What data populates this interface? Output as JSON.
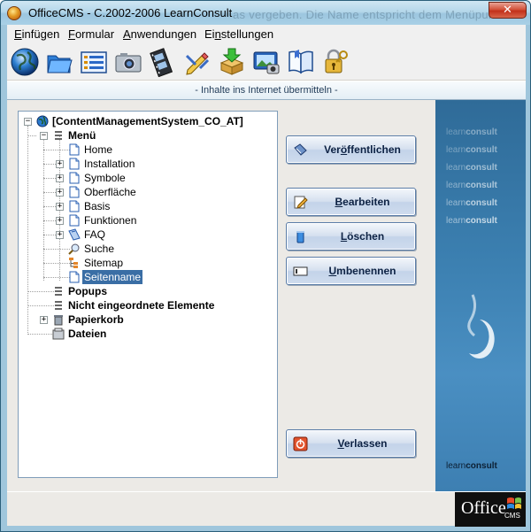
{
  "window": {
    "title": "OfficeCMS - C.2002-2006 LearnConsult",
    "ghost_title": "as vergeben. Die Name entspricht dem Menüpunkt",
    "close_symbol": "✕"
  },
  "menubar": {
    "items": [
      {
        "accel": "E",
        "rest": "infügen"
      },
      {
        "accel": "F",
        "rest": "ormular"
      },
      {
        "accel": "A",
        "rest": "nwendungen"
      },
      {
        "accel": "",
        "pre": "Ei",
        "mid": "n",
        "rest": "stellungen"
      }
    ]
  },
  "toolbar": {
    "icons": [
      "globe-icon",
      "folder-icon",
      "list-form-icon",
      "camera-icon",
      "film-icon",
      "edit-tools-icon",
      "download-package-icon",
      "photo-screen-icon",
      "book-icon",
      "key-lock-icon"
    ]
  },
  "infobar": {
    "text": "- Inhalte ins Internet übermitteln -"
  },
  "tree": {
    "root": "[ContentManagementSystem_CO_AT]",
    "menu": "Menü",
    "menu_children": [
      "Home",
      "Installation",
      "Symbole",
      "Oberfläche",
      "Basis",
      "Funktionen",
      "FAQ",
      "Suche",
      "Sitemap",
      "Seitenname"
    ],
    "popups": "Popups",
    "unsorted": "Nicht eingeordnete Elemente",
    "trash": "Papierkorb",
    "files": "Dateien",
    "selected": "Seitenname"
  },
  "actions": {
    "publish": {
      "accel": "Ver",
      "u": "ö",
      "rest": "ffentlichen"
    },
    "edit": {
      "pre": "",
      "u": "B",
      "rest": "earbeiten"
    },
    "delete": {
      "pre": "",
      "u": "L",
      "rest": "öschen"
    },
    "rename": {
      "pre": "",
      "u": "U",
      "rest": "mbenennen"
    },
    "exit": {
      "pre": "",
      "u": "V",
      "rest": "erlassen"
    }
  },
  "brand": {
    "word_light": "learn",
    "word_bold": "consult",
    "repeat": 6
  },
  "footer": {
    "office_logo_word": "Office",
    "office_logo_sub": "CMS"
  },
  "colors": {
    "brand_blue": "#3b7fb0",
    "selection": "#3a6ea5",
    "button_text": "#0d2244"
  }
}
